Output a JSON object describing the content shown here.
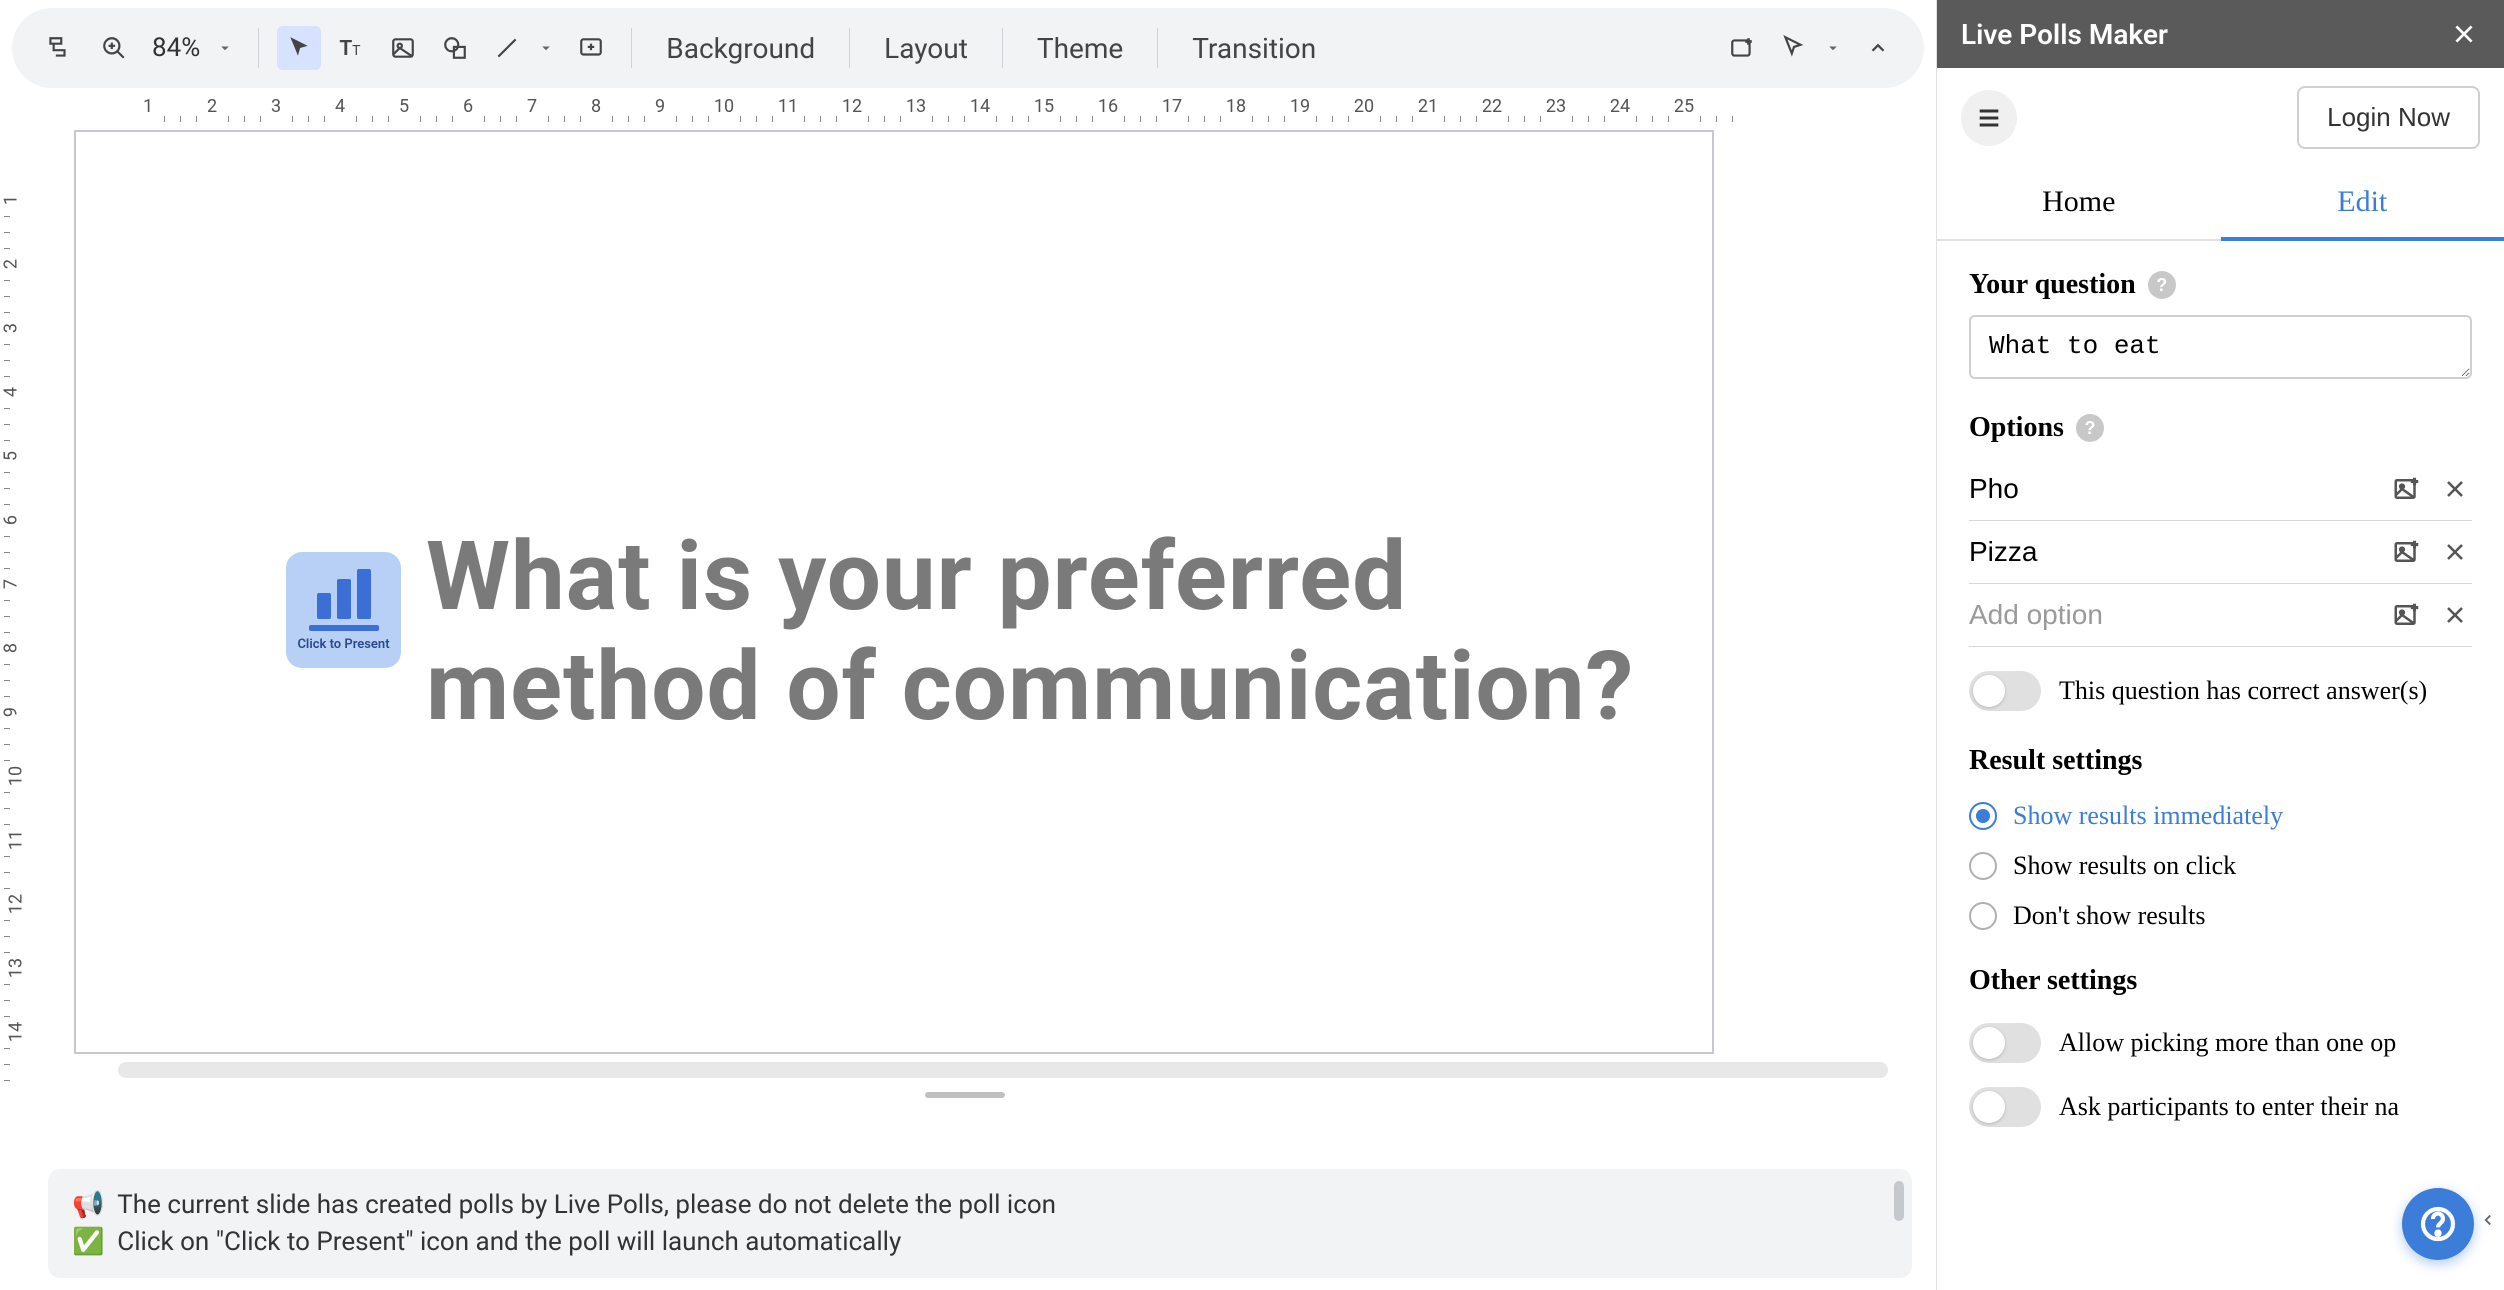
{
  "toolbar": {
    "zoom_value": "84%",
    "background_label": "Background",
    "layout_label": "Layout",
    "theme_label": "Theme",
    "transition_label": "Transition"
  },
  "ruler": {
    "h_ticks": [
      1,
      2,
      3,
      4,
      5,
      6,
      7,
      8,
      9,
      10,
      11,
      12,
      13,
      14,
      15,
      16,
      17,
      18,
      19,
      20,
      21,
      22,
      23,
      24,
      25
    ],
    "v_ticks": [
      1,
      2,
      3,
      4,
      5,
      6,
      7,
      8,
      9,
      10,
      11,
      12,
      13,
      14
    ]
  },
  "slide": {
    "poll_caption": "Click to Present",
    "title": "What is your preferred method of communication?"
  },
  "notes": {
    "line1_icon": "📢",
    "line1": "The current slide has created polls by Live Polls, please do not delete the poll icon",
    "line2_icon": "✅",
    "line2": "Click on \"Click to Present\" icon and the poll will launch automatically"
  },
  "sidebar": {
    "title": "Live Polls Maker",
    "login_label": "Login Now",
    "tabs": {
      "home": "Home",
      "edit": "Edit"
    },
    "question_label": "Your question",
    "question_value": "What to eat",
    "options_label": "Options",
    "options": [
      {
        "text": "Pho"
      },
      {
        "text": "Pizza"
      }
    ],
    "add_option_placeholder": "Add option",
    "correct_answer_label": "This question has correct answer(s)",
    "result_settings_label": "Result settings",
    "result_options": {
      "immediately": "Show results immediately",
      "on_click": "Show results on click",
      "dont_show": "Don't show results"
    },
    "result_selected": "immediately",
    "other_settings_label": "Other settings",
    "allow_multi_label": "Allow picking more than one op",
    "ask_name_label": "Ask participants to enter their na"
  }
}
